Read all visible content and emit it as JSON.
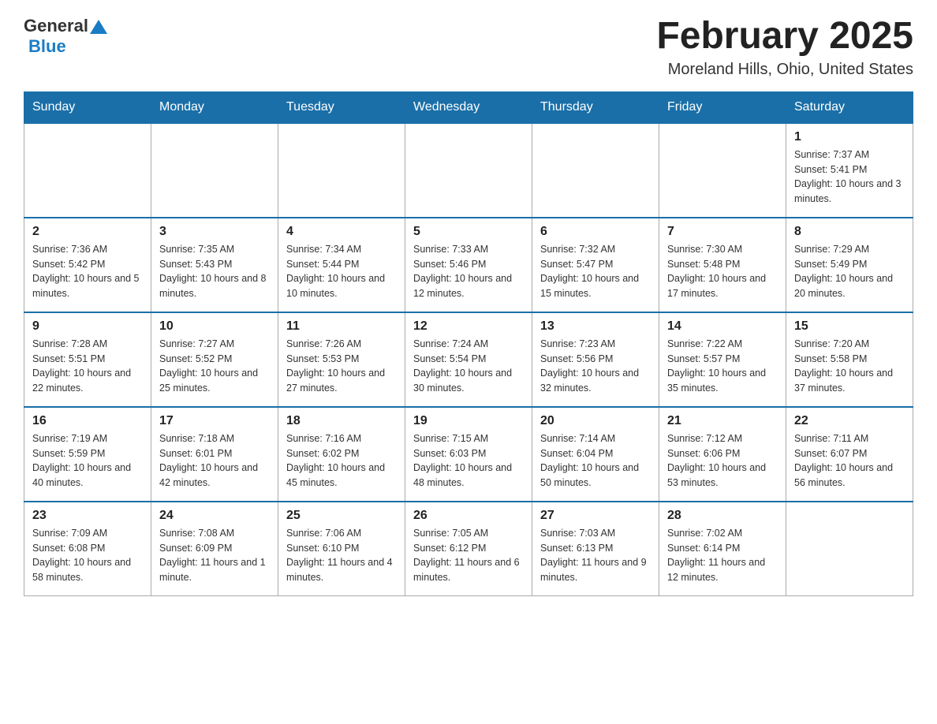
{
  "header": {
    "logo_general": "General",
    "logo_blue": "Blue",
    "title": "February 2025",
    "location": "Moreland Hills, Ohio, United States"
  },
  "weekdays": [
    "Sunday",
    "Monday",
    "Tuesday",
    "Wednesday",
    "Thursday",
    "Friday",
    "Saturday"
  ],
  "weeks": [
    [
      {
        "day": "",
        "info": ""
      },
      {
        "day": "",
        "info": ""
      },
      {
        "day": "",
        "info": ""
      },
      {
        "day": "",
        "info": ""
      },
      {
        "day": "",
        "info": ""
      },
      {
        "day": "",
        "info": ""
      },
      {
        "day": "1",
        "info": "Sunrise: 7:37 AM\nSunset: 5:41 PM\nDaylight: 10 hours and 3 minutes."
      }
    ],
    [
      {
        "day": "2",
        "info": "Sunrise: 7:36 AM\nSunset: 5:42 PM\nDaylight: 10 hours and 5 minutes."
      },
      {
        "day": "3",
        "info": "Sunrise: 7:35 AM\nSunset: 5:43 PM\nDaylight: 10 hours and 8 minutes."
      },
      {
        "day": "4",
        "info": "Sunrise: 7:34 AM\nSunset: 5:44 PM\nDaylight: 10 hours and 10 minutes."
      },
      {
        "day": "5",
        "info": "Sunrise: 7:33 AM\nSunset: 5:46 PM\nDaylight: 10 hours and 12 minutes."
      },
      {
        "day": "6",
        "info": "Sunrise: 7:32 AM\nSunset: 5:47 PM\nDaylight: 10 hours and 15 minutes."
      },
      {
        "day": "7",
        "info": "Sunrise: 7:30 AM\nSunset: 5:48 PM\nDaylight: 10 hours and 17 minutes."
      },
      {
        "day": "8",
        "info": "Sunrise: 7:29 AM\nSunset: 5:49 PM\nDaylight: 10 hours and 20 minutes."
      }
    ],
    [
      {
        "day": "9",
        "info": "Sunrise: 7:28 AM\nSunset: 5:51 PM\nDaylight: 10 hours and 22 minutes."
      },
      {
        "day": "10",
        "info": "Sunrise: 7:27 AM\nSunset: 5:52 PM\nDaylight: 10 hours and 25 minutes."
      },
      {
        "day": "11",
        "info": "Sunrise: 7:26 AM\nSunset: 5:53 PM\nDaylight: 10 hours and 27 minutes."
      },
      {
        "day": "12",
        "info": "Sunrise: 7:24 AM\nSunset: 5:54 PM\nDaylight: 10 hours and 30 minutes."
      },
      {
        "day": "13",
        "info": "Sunrise: 7:23 AM\nSunset: 5:56 PM\nDaylight: 10 hours and 32 minutes."
      },
      {
        "day": "14",
        "info": "Sunrise: 7:22 AM\nSunset: 5:57 PM\nDaylight: 10 hours and 35 minutes."
      },
      {
        "day": "15",
        "info": "Sunrise: 7:20 AM\nSunset: 5:58 PM\nDaylight: 10 hours and 37 minutes."
      }
    ],
    [
      {
        "day": "16",
        "info": "Sunrise: 7:19 AM\nSunset: 5:59 PM\nDaylight: 10 hours and 40 minutes."
      },
      {
        "day": "17",
        "info": "Sunrise: 7:18 AM\nSunset: 6:01 PM\nDaylight: 10 hours and 42 minutes."
      },
      {
        "day": "18",
        "info": "Sunrise: 7:16 AM\nSunset: 6:02 PM\nDaylight: 10 hours and 45 minutes."
      },
      {
        "day": "19",
        "info": "Sunrise: 7:15 AM\nSunset: 6:03 PM\nDaylight: 10 hours and 48 minutes."
      },
      {
        "day": "20",
        "info": "Sunrise: 7:14 AM\nSunset: 6:04 PM\nDaylight: 10 hours and 50 minutes."
      },
      {
        "day": "21",
        "info": "Sunrise: 7:12 AM\nSunset: 6:06 PM\nDaylight: 10 hours and 53 minutes."
      },
      {
        "day": "22",
        "info": "Sunrise: 7:11 AM\nSunset: 6:07 PM\nDaylight: 10 hours and 56 minutes."
      }
    ],
    [
      {
        "day": "23",
        "info": "Sunrise: 7:09 AM\nSunset: 6:08 PM\nDaylight: 10 hours and 58 minutes."
      },
      {
        "day": "24",
        "info": "Sunrise: 7:08 AM\nSunset: 6:09 PM\nDaylight: 11 hours and 1 minute."
      },
      {
        "day": "25",
        "info": "Sunrise: 7:06 AM\nSunset: 6:10 PM\nDaylight: 11 hours and 4 minutes."
      },
      {
        "day": "26",
        "info": "Sunrise: 7:05 AM\nSunset: 6:12 PM\nDaylight: 11 hours and 6 minutes."
      },
      {
        "day": "27",
        "info": "Sunrise: 7:03 AM\nSunset: 6:13 PM\nDaylight: 11 hours and 9 minutes."
      },
      {
        "day": "28",
        "info": "Sunrise: 7:02 AM\nSunset: 6:14 PM\nDaylight: 11 hours and 12 minutes."
      },
      {
        "day": "",
        "info": ""
      }
    ]
  ]
}
